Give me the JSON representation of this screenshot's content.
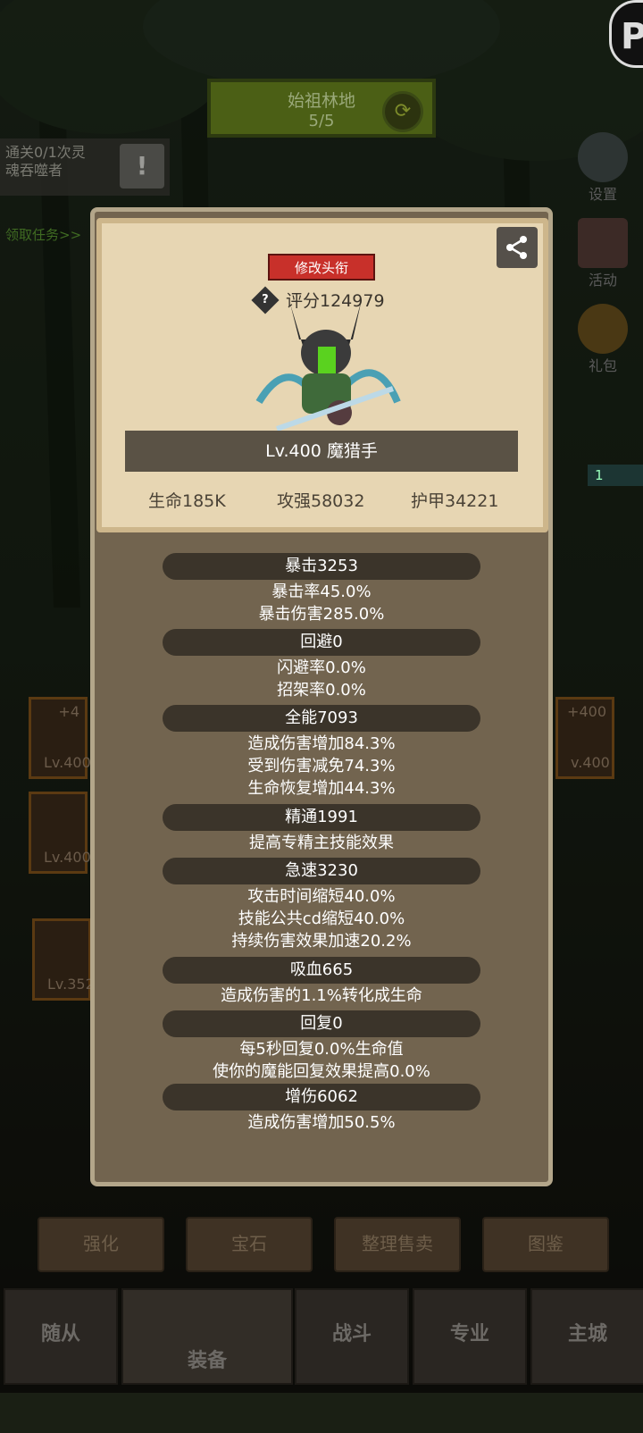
{
  "stage": {
    "name": "始祖林地",
    "progress": "5/5"
  },
  "quest": {
    "text_line1": "通关0/1次灵",
    "text_line2": "魂吞噬者",
    "get_task": "领取任务>>"
  },
  "side_menu": [
    {
      "label": "设置"
    },
    {
      "label": "活动"
    },
    {
      "label": "礼包"
    }
  ],
  "corner_logo": "P",
  "side_counter": "1",
  "slots": [
    {
      "level": "Lv.400",
      "plus": "+4"
    },
    {
      "level": "Lv.400"
    },
    {
      "level": "Lv.352"
    },
    {
      "level": "v.400",
      "plus": "+400"
    }
  ],
  "bottom_buttons": [
    "强化",
    "宝石",
    "整理售卖",
    "图鉴"
  ],
  "tabs": [
    "随从",
    "装备",
    "战斗",
    "专业",
    "主城"
  ],
  "card": {
    "edit_title_button": "修改头衔",
    "score_label": "评分124979",
    "hero_name": "Lv.400 魔猎手",
    "hp": "生命185K",
    "attack": "攻强58032",
    "armor": "护甲34221"
  },
  "stats": [
    {
      "header": "暴击3253",
      "lines": [
        "暴击率45.0%",
        "暴击伤害285.0%"
      ]
    },
    {
      "header": "回避0",
      "lines": [
        "闪避率0.0%",
        "招架率0.0%"
      ]
    },
    {
      "header": "全能7093",
      "lines": [
        "造成伤害增加84.3%",
        "受到伤害减免74.3%",
        "生命恢复增加44.3%"
      ]
    },
    {
      "header": "精通1991",
      "lines": [
        "提高专精主技能效果"
      ]
    },
    {
      "header": "急速3230",
      "lines": [
        "攻击时间缩短40.0%",
        "技能公共cd缩短40.0%",
        "持续伤害效果加速20.2%"
      ]
    },
    {
      "header": "吸血665",
      "lines": [
        "造成伤害的1.1%转化成生命"
      ]
    },
    {
      "header": "回复0",
      "lines": [
        "每5秒回复0.0%生命值",
        "使你的魔能回复效果提高0.0%"
      ]
    },
    {
      "header": "增伤6062",
      "lines": [
        "造成伤害增加50.5%"
      ]
    }
  ]
}
